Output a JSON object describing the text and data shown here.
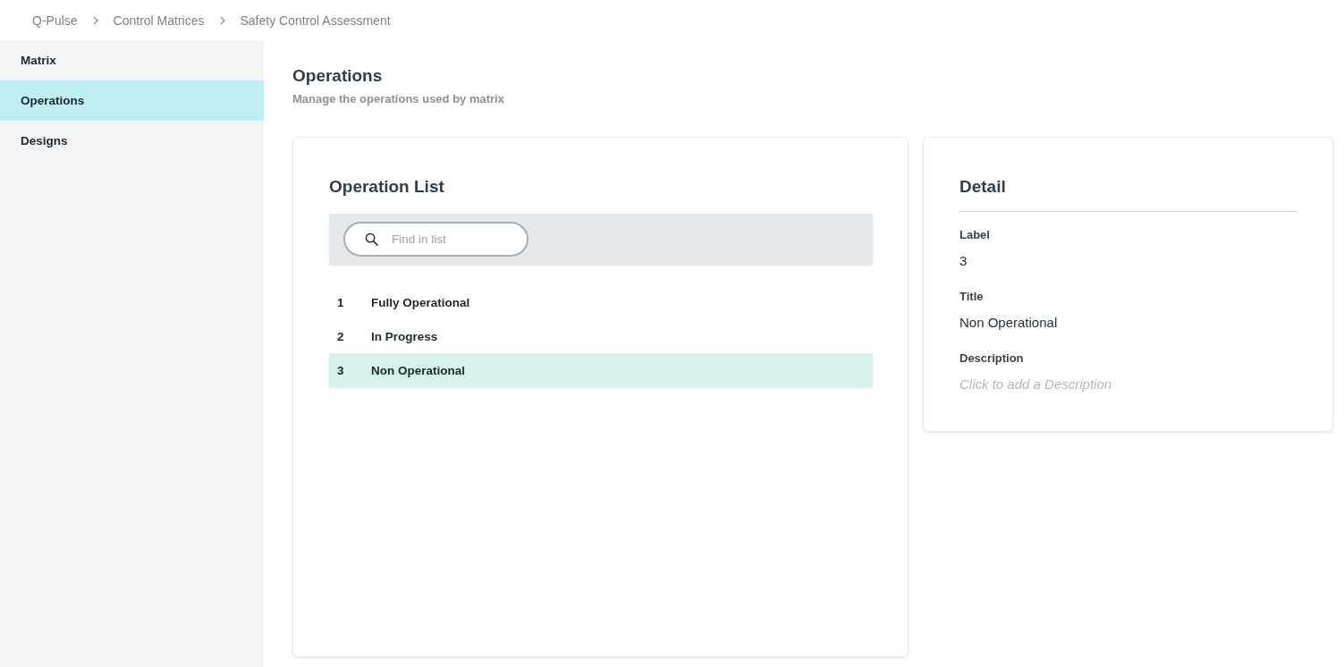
{
  "breadcrumb": [
    "Q-Pulse",
    "Control Matrices",
    "Safety Control Assessment"
  ],
  "sidebar": {
    "items": [
      {
        "label": "Matrix",
        "selected": false
      },
      {
        "label": "Operations",
        "selected": true
      },
      {
        "label": "Designs",
        "selected": false
      }
    ]
  },
  "page": {
    "title": "Operations",
    "subtitle": "Manage the operations used by matrix"
  },
  "operation_list": {
    "title": "Operation List",
    "search": {
      "placeholder": "Find in list"
    },
    "rows": [
      {
        "number": "1",
        "title": "Fully Operational",
        "selected": false
      },
      {
        "number": "2",
        "title": "In Progress",
        "selected": false
      },
      {
        "number": "3",
        "title": "Non Operational",
        "selected": true
      }
    ]
  },
  "detail": {
    "title": "Detail",
    "fields": [
      {
        "label": "Label",
        "value": "3"
      },
      {
        "label": "Title",
        "value": "Non Operational"
      },
      {
        "label": "Description",
        "placeholder": "Click to add a Description"
      }
    ]
  }
}
